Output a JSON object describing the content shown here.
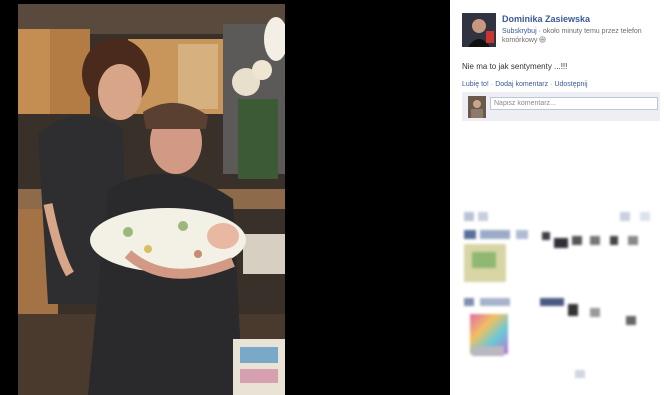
{
  "post": {
    "author": "Dominika Zasiewska",
    "subscribe_label": "Subskrybuj",
    "meta_separator": " · ",
    "meta_text": "około minuty temu przez telefon komórkowy",
    "privacy_icon": "globe-icon",
    "text": "Nie ma to jak sentymenty ...!!!"
  },
  "actions": {
    "like": "Lubię to!",
    "comment": "Dodaj komentarz",
    "share": "Udostępnij",
    "separator": "·"
  },
  "comment_box": {
    "placeholder": "Napisz komentarz..."
  },
  "colors": {
    "link": "#3b5998",
    "viewer_bg": "#000000",
    "comment_bg": "#edeff4"
  }
}
